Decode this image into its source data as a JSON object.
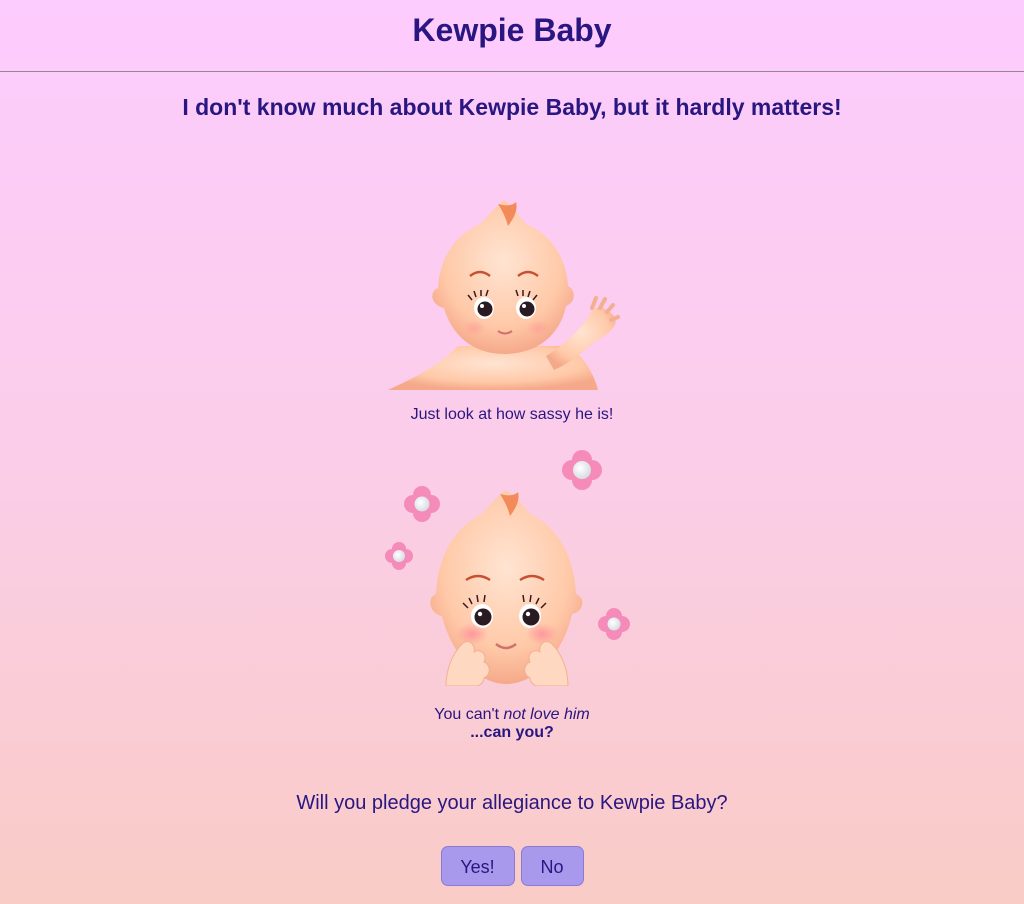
{
  "header": {
    "title": "Kewpie Baby"
  },
  "main": {
    "subtitle": "I don't know much about Kewpie Baby, but it hardly matters!",
    "figure1": {
      "caption": "Just look at how sassy he is!"
    },
    "figure2": {
      "caption_prefix": "You can't ",
      "caption_emphasis": "not love him",
      "caption_strong": "...can you?"
    },
    "question": "Will you pledge your allegiance to Kewpie Baby?",
    "buttons": {
      "yes_label": "Yes!",
      "no_label": "No"
    }
  },
  "colors": {
    "text": "#2a1680",
    "button_bg": "#a899ec",
    "bg_top": "#fdccfe",
    "bg_bottom": "#f9ccc6"
  },
  "icons": [
    "kewpie-waving-image",
    "kewpie-cheeks-image",
    "flower-icon"
  ]
}
